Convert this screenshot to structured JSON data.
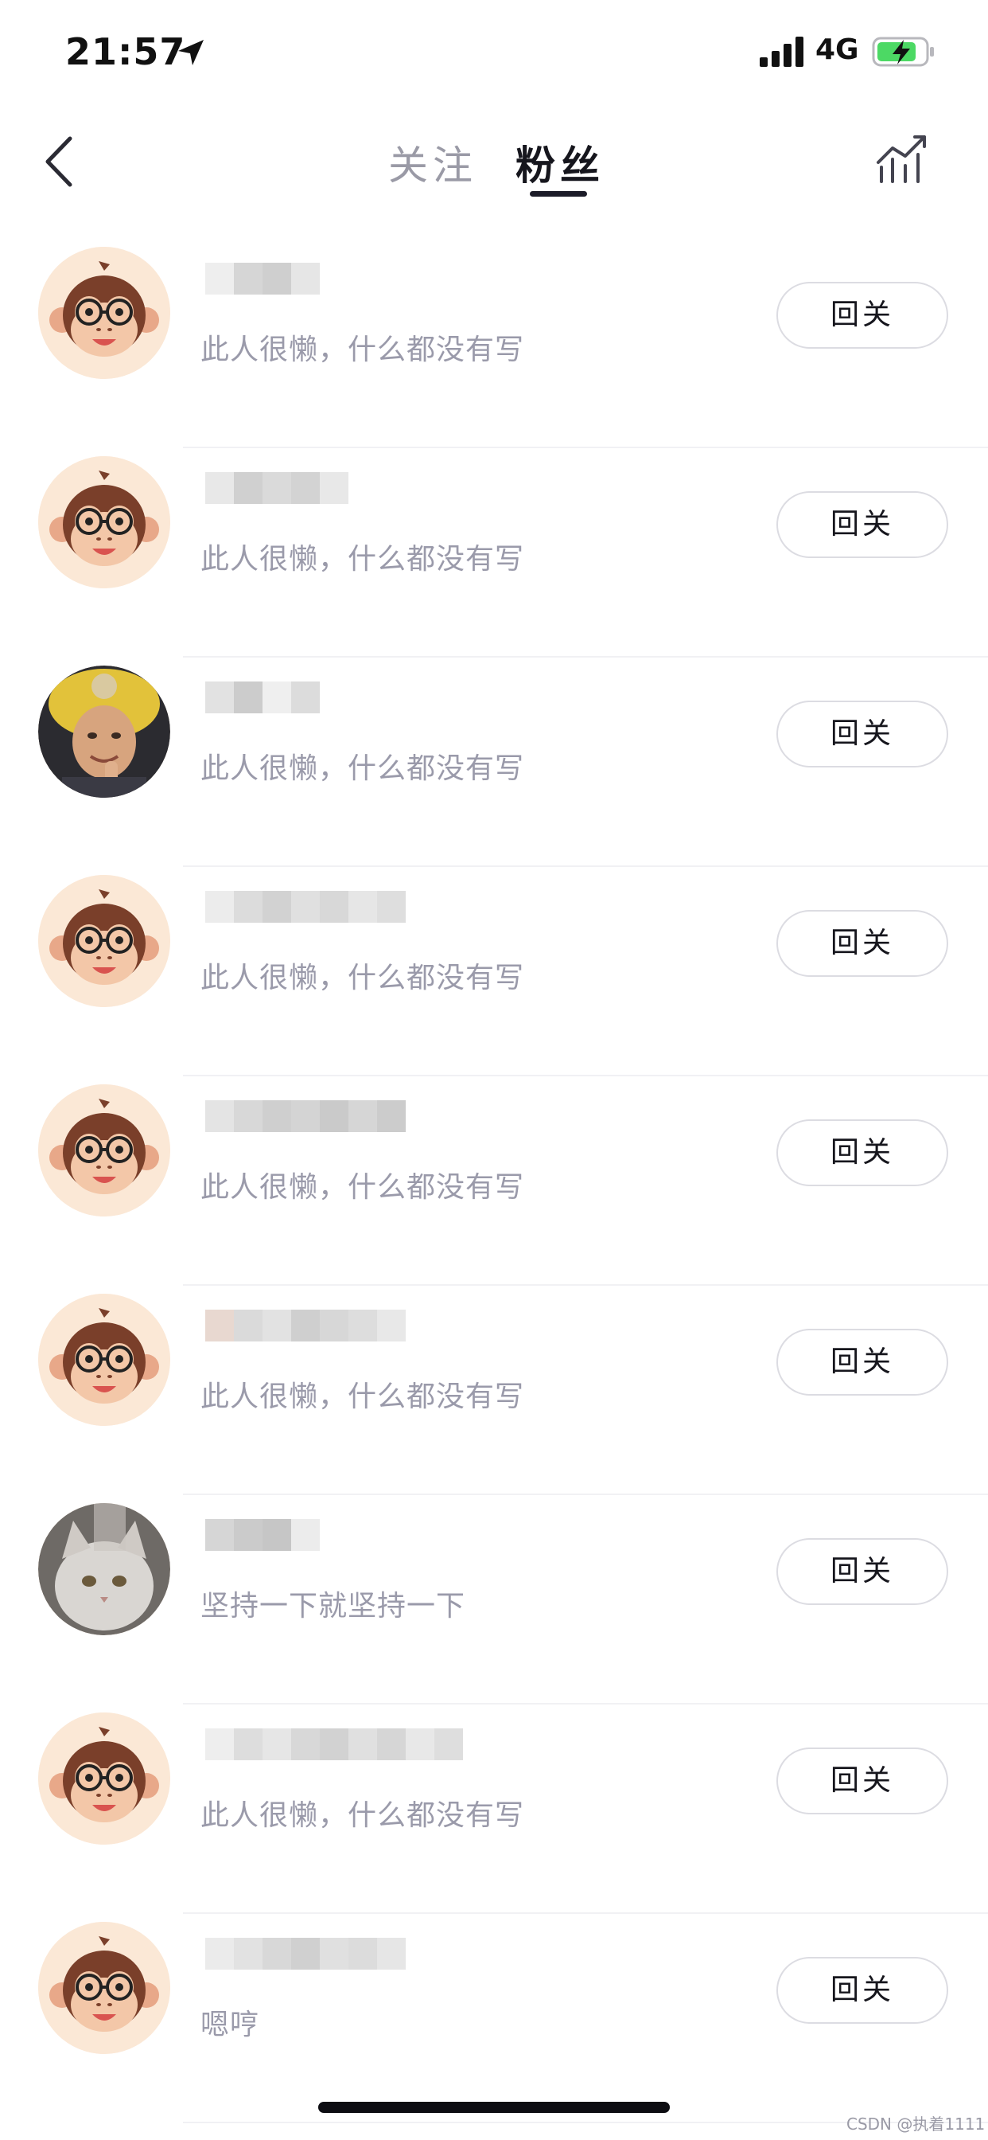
{
  "status_bar": {
    "time": "21:57",
    "network": "4G",
    "icons": [
      "location-arrow-icon",
      "cellular-signal-icon",
      "battery-charging-icon"
    ]
  },
  "nav": {
    "back_icon": "chevron-left-icon",
    "tabs": [
      {
        "label": "关注",
        "active": false
      },
      {
        "label": "粉丝",
        "active": true
      }
    ],
    "stats_icon": "chart-trend-icon"
  },
  "followers": [
    {
      "avatar": "monkey-avatar",
      "bio": "此人很懒，什么都没有写",
      "button": "回关"
    },
    {
      "avatar": "monkey-avatar",
      "bio": "此人很懒，什么都没有写",
      "button": "回关"
    },
    {
      "avatar": "photo-avatar",
      "bio": "此人很懒，什么都没有写",
      "button": "回关"
    },
    {
      "avatar": "monkey-avatar",
      "bio": "此人很懒，什么都没有写",
      "button": "回关"
    },
    {
      "avatar": "monkey-avatar",
      "bio": "此人很懒，什么都没有写",
      "button": "回关"
    },
    {
      "avatar": "monkey-avatar",
      "bio": "此人很懒，什么都没有写",
      "button": "回关"
    },
    {
      "avatar": "cat-photo-avatar",
      "bio": "坚持一下就坚持一下",
      "button": "回关"
    },
    {
      "avatar": "monkey-avatar",
      "bio": "此人很懒，什么都没有写",
      "button": "回关"
    },
    {
      "avatar": "monkey-avatar",
      "bio": "嗯哼",
      "button": "回关"
    }
  ],
  "watermark": "CSDN @执着1111",
  "colors": {
    "active_tab": "#16161d",
    "inactive_tab": "#9a9aa6",
    "bio_text": "#9a9aaa",
    "button_border": "#dcdce2",
    "avatar_bg": "#fbe8d6"
  }
}
